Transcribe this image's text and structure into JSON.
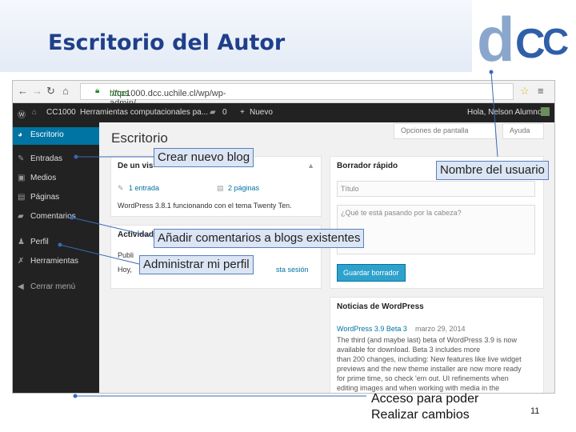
{
  "slide": {
    "title": "Escritorio del Autor",
    "logo_text": "dCC",
    "page_number": "11"
  },
  "browser": {
    "url_https": "https",
    "url_rest": "://cc1000.dcc.uchile.cl/wp/wp-admin/"
  },
  "adminbar": {
    "site_name": "CC1000",
    "site_title": "Herramientas computacionales pa...",
    "comments_count": "0",
    "new_label": "Nuevo",
    "user_greeting": "Hola, Nelson Alumno"
  },
  "sidebar": {
    "items": [
      {
        "label": "Escritorio",
        "icon": "dashboard-icon"
      },
      {
        "label": "Entradas",
        "icon": "pin-icon"
      },
      {
        "label": "Medios",
        "icon": "media-icon"
      },
      {
        "label": "Páginas",
        "icon": "pages-icon"
      },
      {
        "label": "Comentarios",
        "icon": "comments-icon"
      },
      {
        "label": "Perfil",
        "icon": "user-icon"
      },
      {
        "label": "Herramientas",
        "icon": "tools-icon"
      },
      {
        "label": "Cerrar menú",
        "icon": "collapse-icon"
      }
    ]
  },
  "content": {
    "page_title": "Escritorio",
    "screen_options": "Opciones de pantalla",
    "help": "Ayuda",
    "glance": {
      "title": "De un vis",
      "entries": "1 entrada",
      "pages": "2 páginas",
      "theme_line": "WordPress 3.8.1 funcionando con el tema Twenty Ten."
    },
    "activity": {
      "title": "Actividad",
      "published": "Publi",
      "hello": "Hoy,",
      "logout_hint": "sta sesión"
    },
    "quick_draft": {
      "title": "Borrador rápido",
      "title_placeholder": "Título",
      "body_placeholder": "¿Qué te está pasando por la cabeza?",
      "save_button": "Guardar borrador"
    },
    "news": {
      "title": "Noticias de WordPress",
      "headline": "WordPress 3.9 Beta 3",
      "date": "marzo 29, 2014",
      "lines": [
        "The third (and maybe last) beta of WordPress 3.9 is now",
        "available for download. Beta 3 includes more",
        "than 200 changes, including: New features like live widget",
        "previews and the new theme installer are now more ready",
        "for prime time, so check 'em out. UI refinements when",
        "editing images and when working with media in the"
      ]
    }
  },
  "callouts": {
    "new_blog": "Crear nuevo blog",
    "user_name": "Nombre del usuario",
    "comments": "Añadir comentarios a blogs existentes",
    "profile": "Administrar mi perfil",
    "access_line1": "Acceso para poder",
    "access_line2": "Realizar cambios"
  },
  "colors": {
    "title_blue": "#1f3f8a",
    "wp_admin_dark": "#222222",
    "wp_active_blue": "#0074a2",
    "callout_fill": "#dbe5f3"
  }
}
